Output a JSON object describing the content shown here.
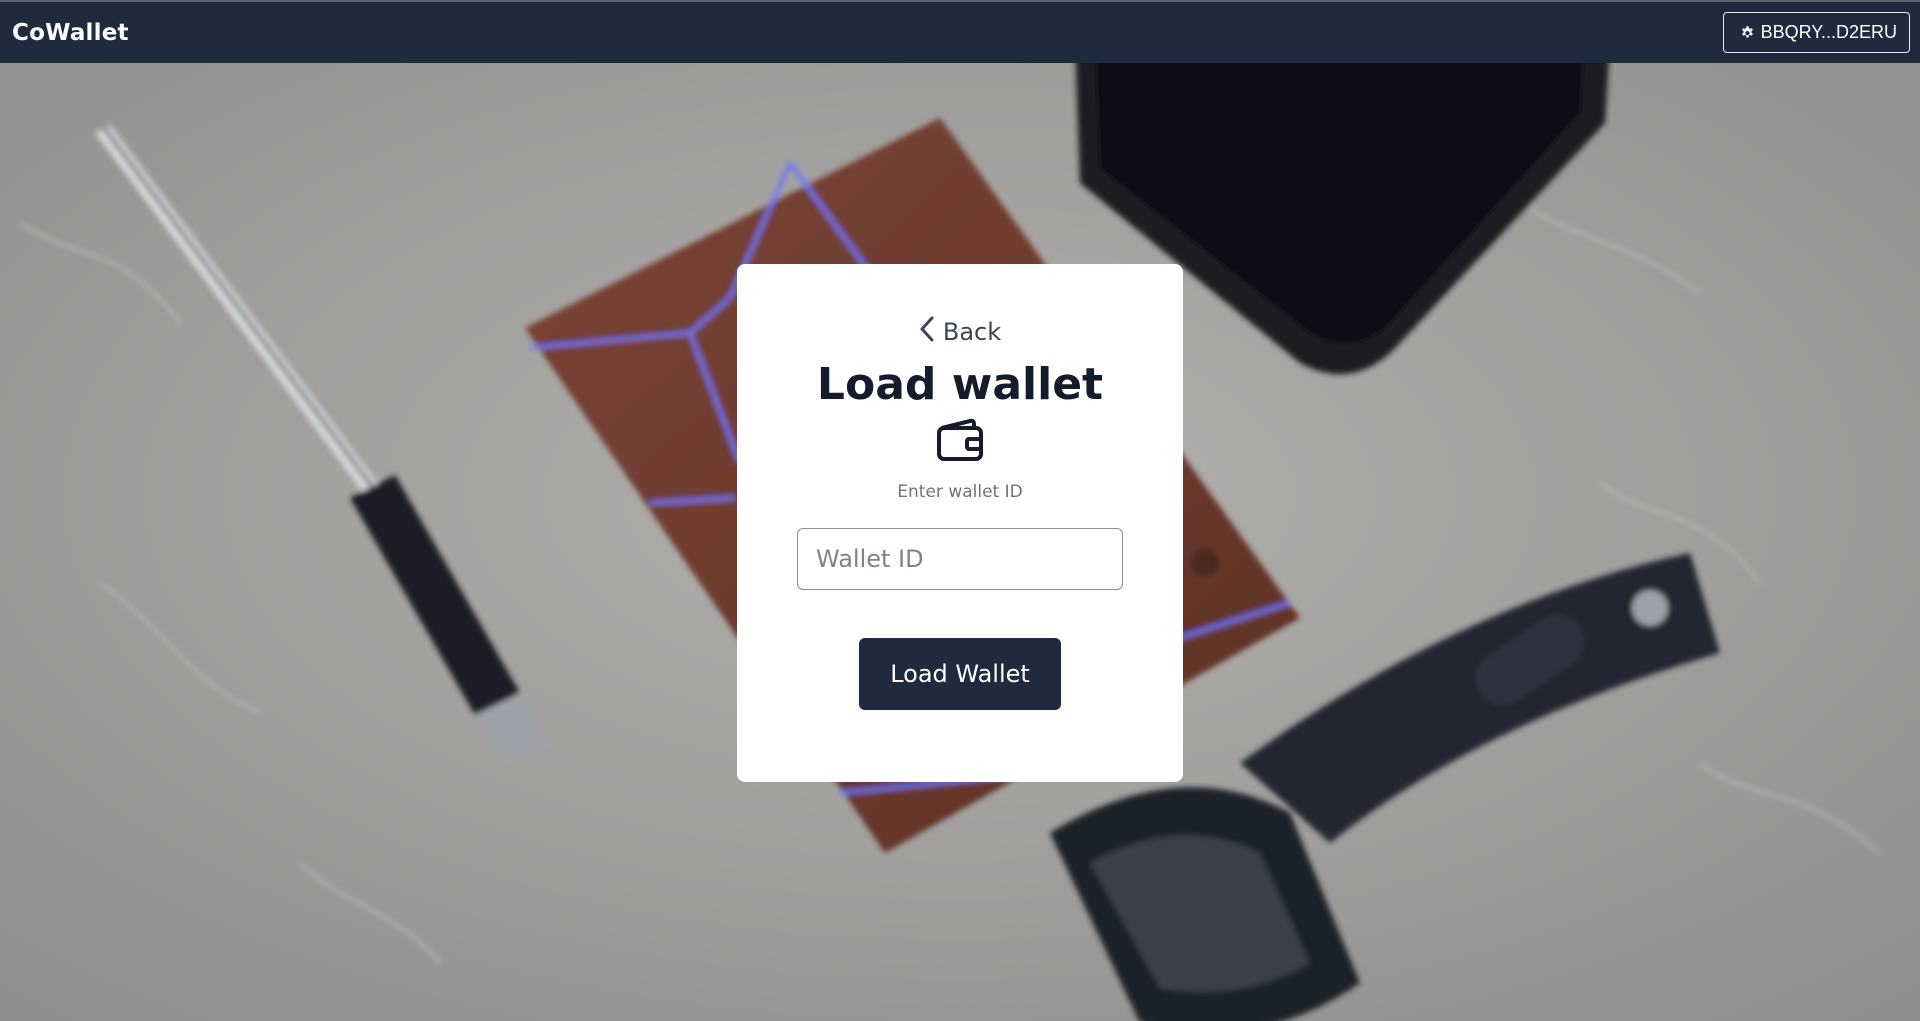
{
  "app": {
    "brand": "CoWallet"
  },
  "header": {
    "account_label": "BBQRY...D2ERU",
    "account_icon": "gear-icon"
  },
  "card": {
    "back_label": "Back",
    "title": "Load wallet",
    "icon": "wallet-icon",
    "subtitle": "Enter wallet ID",
    "input_placeholder": "Wallet ID",
    "input_value": "",
    "submit_label": "Load Wallet"
  },
  "colors": {
    "navbar": "#1f2a3d",
    "primary_button": "#1f2a3d",
    "card": "#ffffff",
    "title_text": "#141b2c"
  }
}
